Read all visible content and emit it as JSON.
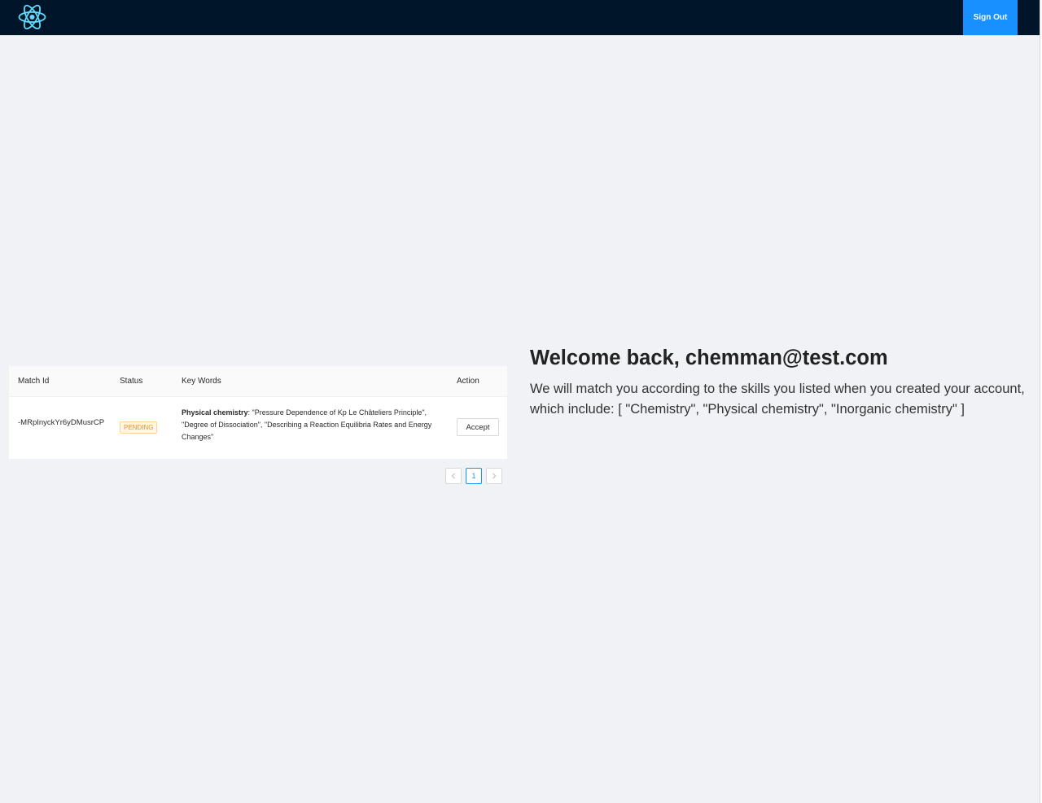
{
  "header": {
    "logo_icon": "react-atom-icon",
    "signout_label": "Sign Out",
    "accent": "#1890ff",
    "background": "#001529"
  },
  "table": {
    "columns": [
      "Match Id",
      "Status",
      "Key Words",
      "Action"
    ],
    "rows": [
      {
        "match_id": "-MRpInyckYr6yDMusrCP",
        "status": "PENDING",
        "keyword_subject": "Physical chemistry",
        "keyword_list": ": \"Pressure Dependence of Kp Le Châteliers Principle\", \"Degree of Dissociation\", \"Describing a Reaction Equilibria Rates and Energy Changes\"",
        "action_label": "Accept"
      }
    ]
  },
  "pagination": {
    "prev_icon": "chevron-left-icon",
    "current_page": "1",
    "next_icon": "chevron-right-icon"
  },
  "welcome": {
    "title": "Welcome back, chemman@test.com",
    "message": "We will match you according to the skills you listed when you created your account, which include: [ \"Chemistry\", \"Physical chemistry\", \"Inorganic chemistry\" ]"
  }
}
